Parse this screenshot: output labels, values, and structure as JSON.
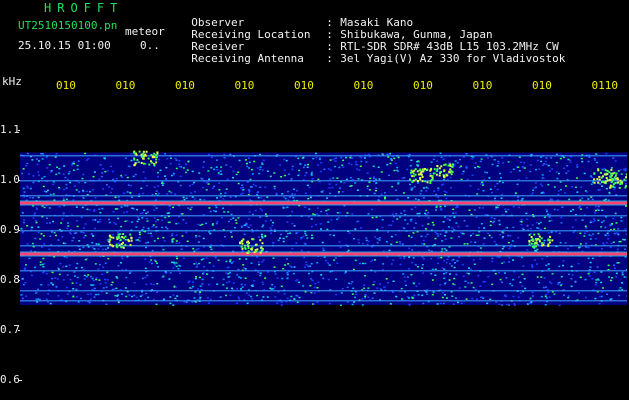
{
  "header": {
    "brand": "HROFFT",
    "file_name": "UT2510150100.pn",
    "mode": "meteor",
    "timestamp": "25.10.15 01:00",
    "timestamp_extra": "0..",
    "info": [
      {
        "key": "Observer",
        "sep": ":",
        "value": "Masaki Kano"
      },
      {
        "key": "Receiving Location",
        "sep": ":",
        "value": "Shibukawa, Gunma, Japan"
      },
      {
        "key": "Receiver",
        "sep": ":",
        "value": "RTL-SDR SDR# 43dB L15 103.2MHz CW"
      },
      {
        "key": "Receiving Antenna",
        "sep": ":",
        "value": "3el Yagi(V) Az 330 for Vladivostok"
      }
    ]
  },
  "colors": {
    "header_green": "#22e05a",
    "axis_yellow": "#f0f000",
    "background": "#000000",
    "spectrogram_bg": "#000080",
    "amplitude_fill": "#f0f000"
  },
  "chart_data": {
    "type": "heatmap",
    "title": "",
    "ylabel": "kHz",
    "xlabel": "",
    "y_ticks": [
      "1.1",
      "1.0",
      "0.9",
      "0.8",
      "0.7",
      "0.6"
    ],
    "x_ticks": [
      "010",
      "010",
      "010",
      "010",
      "010",
      "010",
      "010",
      "010",
      "010",
      "0110"
    ],
    "ylim": [
      0.6,
      1.1
    ],
    "signal_band": [
      0.75,
      1.055
    ],
    "strong_carriers_khz": [
      0.955,
      0.853
    ],
    "amplitude_strip": "yellow fill along bottom, level ~0.3 of strip height"
  }
}
